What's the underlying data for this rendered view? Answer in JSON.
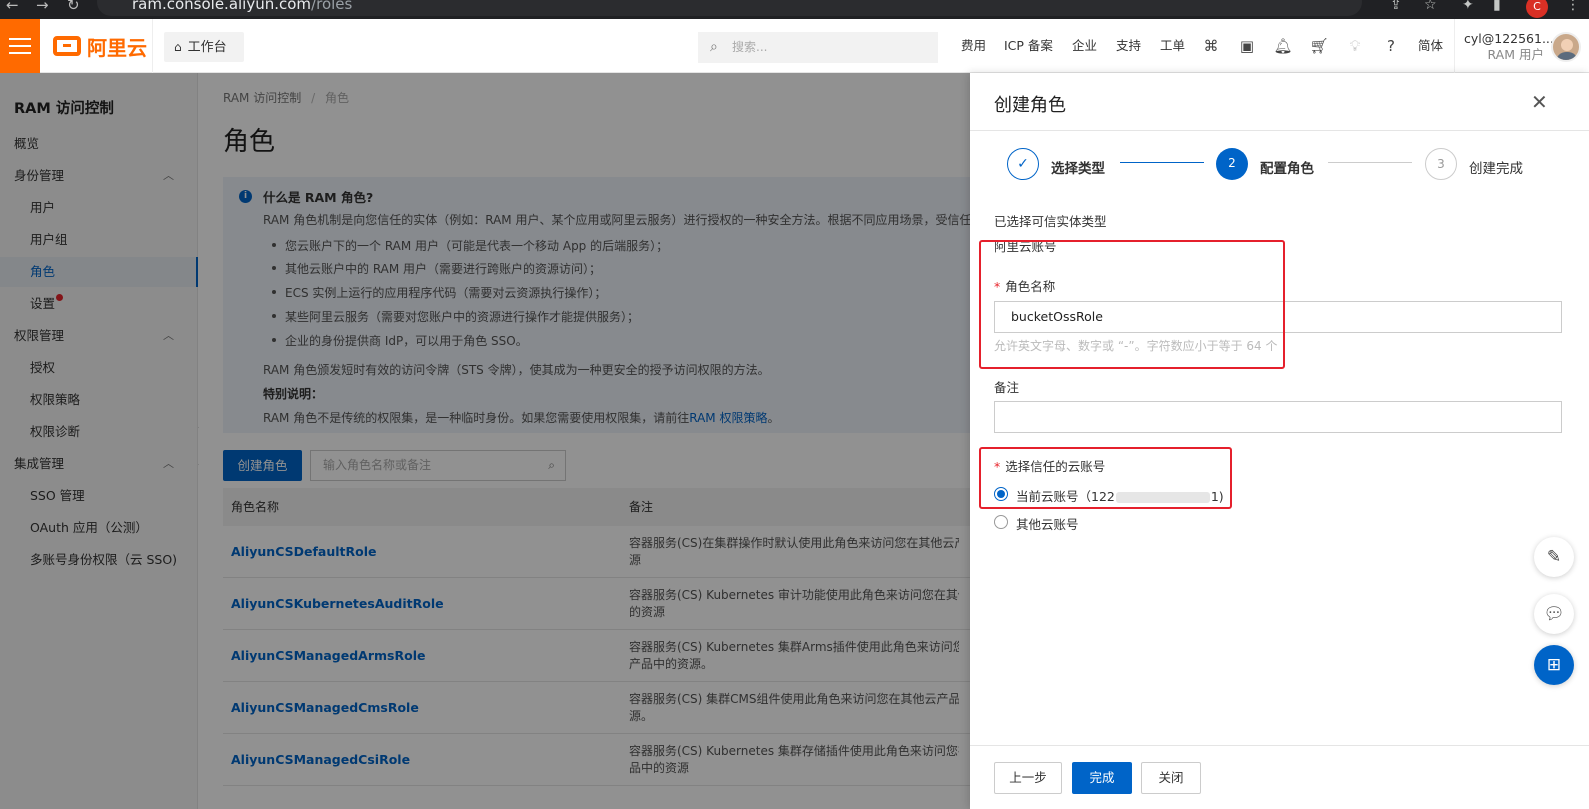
{
  "browser": {
    "url_host": "ram.console.aliyun.com",
    "url_path": "/roles",
    "profile_initial": "C"
  },
  "topbar": {
    "logo_text": "阿里云",
    "workbench": "工作台",
    "search_placeholder": "搜索...",
    "nav": [
      "费用",
      "ICP 备案",
      "企业",
      "支持",
      "工单"
    ],
    "lang": "简体",
    "user_name": "cyl@122561...",
    "user_role": "RAM 用户"
  },
  "sidebar": {
    "title": "RAM 访问控制",
    "items": [
      {
        "label": "概览"
      },
      {
        "label": "身份管理"
      },
      {
        "label": "用户"
      },
      {
        "label": "用户组"
      },
      {
        "label": "角色"
      },
      {
        "label": "设置"
      },
      {
        "label": "权限管理"
      },
      {
        "label": "授权"
      },
      {
        "label": "权限策略"
      },
      {
        "label": "权限诊断"
      },
      {
        "label": "集成管理"
      },
      {
        "label": "SSO 管理"
      },
      {
        "label": "OAuth 应用（公测）"
      },
      {
        "label": "多账号身份权限（云 SSO)"
      }
    ]
  },
  "main": {
    "breadcrumb_root": "RAM 访问控制",
    "breadcrumb_sep": "/",
    "breadcrumb_current": "角色",
    "title": "角色",
    "info": {
      "heading": "什么是 RAM 角色?",
      "intro": "RAM 角色机制是向您信任的实体（例如：RAM 用户、某个应用或阿里云服务）进行授权的一种安全方法。根据不同应用场景，受信任",
      "bullets": [
        "您云账户下的一个 RAM 用户（可能是代表一个移动 App 的后端服务）；",
        "其他云账户中的 RAM 用户（需要进行跨账户的资源访问）；",
        "ECS 实例上运行的应用程序代码（需要对云资源执行操作）；",
        "某些阿里云服务（需要对您账户中的资源进行操作才能提供服务）；",
        "企业的身份提供商 IdP，可以用于角色 SSO。"
      ],
      "sts": "RAM 角色颁发短时有效的访问令牌（STS 令牌），使其成为一种更安全的授予访问权限的方法。",
      "special": "特别说明：",
      "note_prefix": "RAM 角色不是传统的权限集，是一种临时身份。如果您需要使用权限集，请前往",
      "note_link": "RAM 权限策略",
      "note_suffix": "。"
    },
    "create_button": "创建角色",
    "search_placeholder": "输入角色名称或备注",
    "table": {
      "headers": [
        "角色名称",
        "备注"
      ],
      "rows": [
        {
          "name": "AliyunCSDefaultRole",
          "note1": "容器服务(CS)在集群操作时默认使用此角色来访问您在其他云产",
          "note2": "源"
        },
        {
          "name": "AliyunCSKubernetesAuditRole",
          "note1": "容器服务(CS) Kubernetes 审计功能使用此角色来访问您在其他",
          "note2": "的资源"
        },
        {
          "name": "AliyunCSManagedArmsRole",
          "note1": "容器服务(CS) Kubernetes 集群Arms插件使用此角色来访问您在",
          "note2": "产品中的资源。"
        },
        {
          "name": "AliyunCSManagedCmsRole",
          "note1": "容器服务(CS) 集群CMS组件使用此角色来访问您在其他云产品中",
          "note2": "源。"
        },
        {
          "name": "AliyunCSManagedCsiRole",
          "note1": "容器服务(CS) Kubernetes 集群存储插件使用此角色来访问您在",
          "note2": "品中的资源"
        }
      ]
    }
  },
  "drawer": {
    "title": "创建角色",
    "steps": [
      {
        "num": "✓",
        "label": "选择类型",
        "state": "done"
      },
      {
        "num": "2",
        "label": "配置角色",
        "state": "active"
      },
      {
        "num": "3",
        "label": "创建完成",
        "state": "pending"
      }
    ],
    "entity_type_label": "已选择可信实体类型",
    "entity_type_value": "阿里云账号",
    "role_name_label": "角色名称",
    "role_name_value": "bucketOssRole",
    "role_name_hint": "允许英文字母、数字或 “-”。字符数应小于等于 64 个",
    "remark_label": "备注",
    "remark_value": "",
    "trust_label": "选择信任的云账号",
    "radio_current_prefix": "当前云账号（122",
    "radio_current_suffix": "1)",
    "radio_other": "其他云账号",
    "footer": {
      "prev": "上一步",
      "finish": "完成",
      "close": "关闭"
    }
  },
  "colors": {
    "brand": "#ff6a00",
    "primary": "#0064c8",
    "highlight": "#e5202c"
  }
}
